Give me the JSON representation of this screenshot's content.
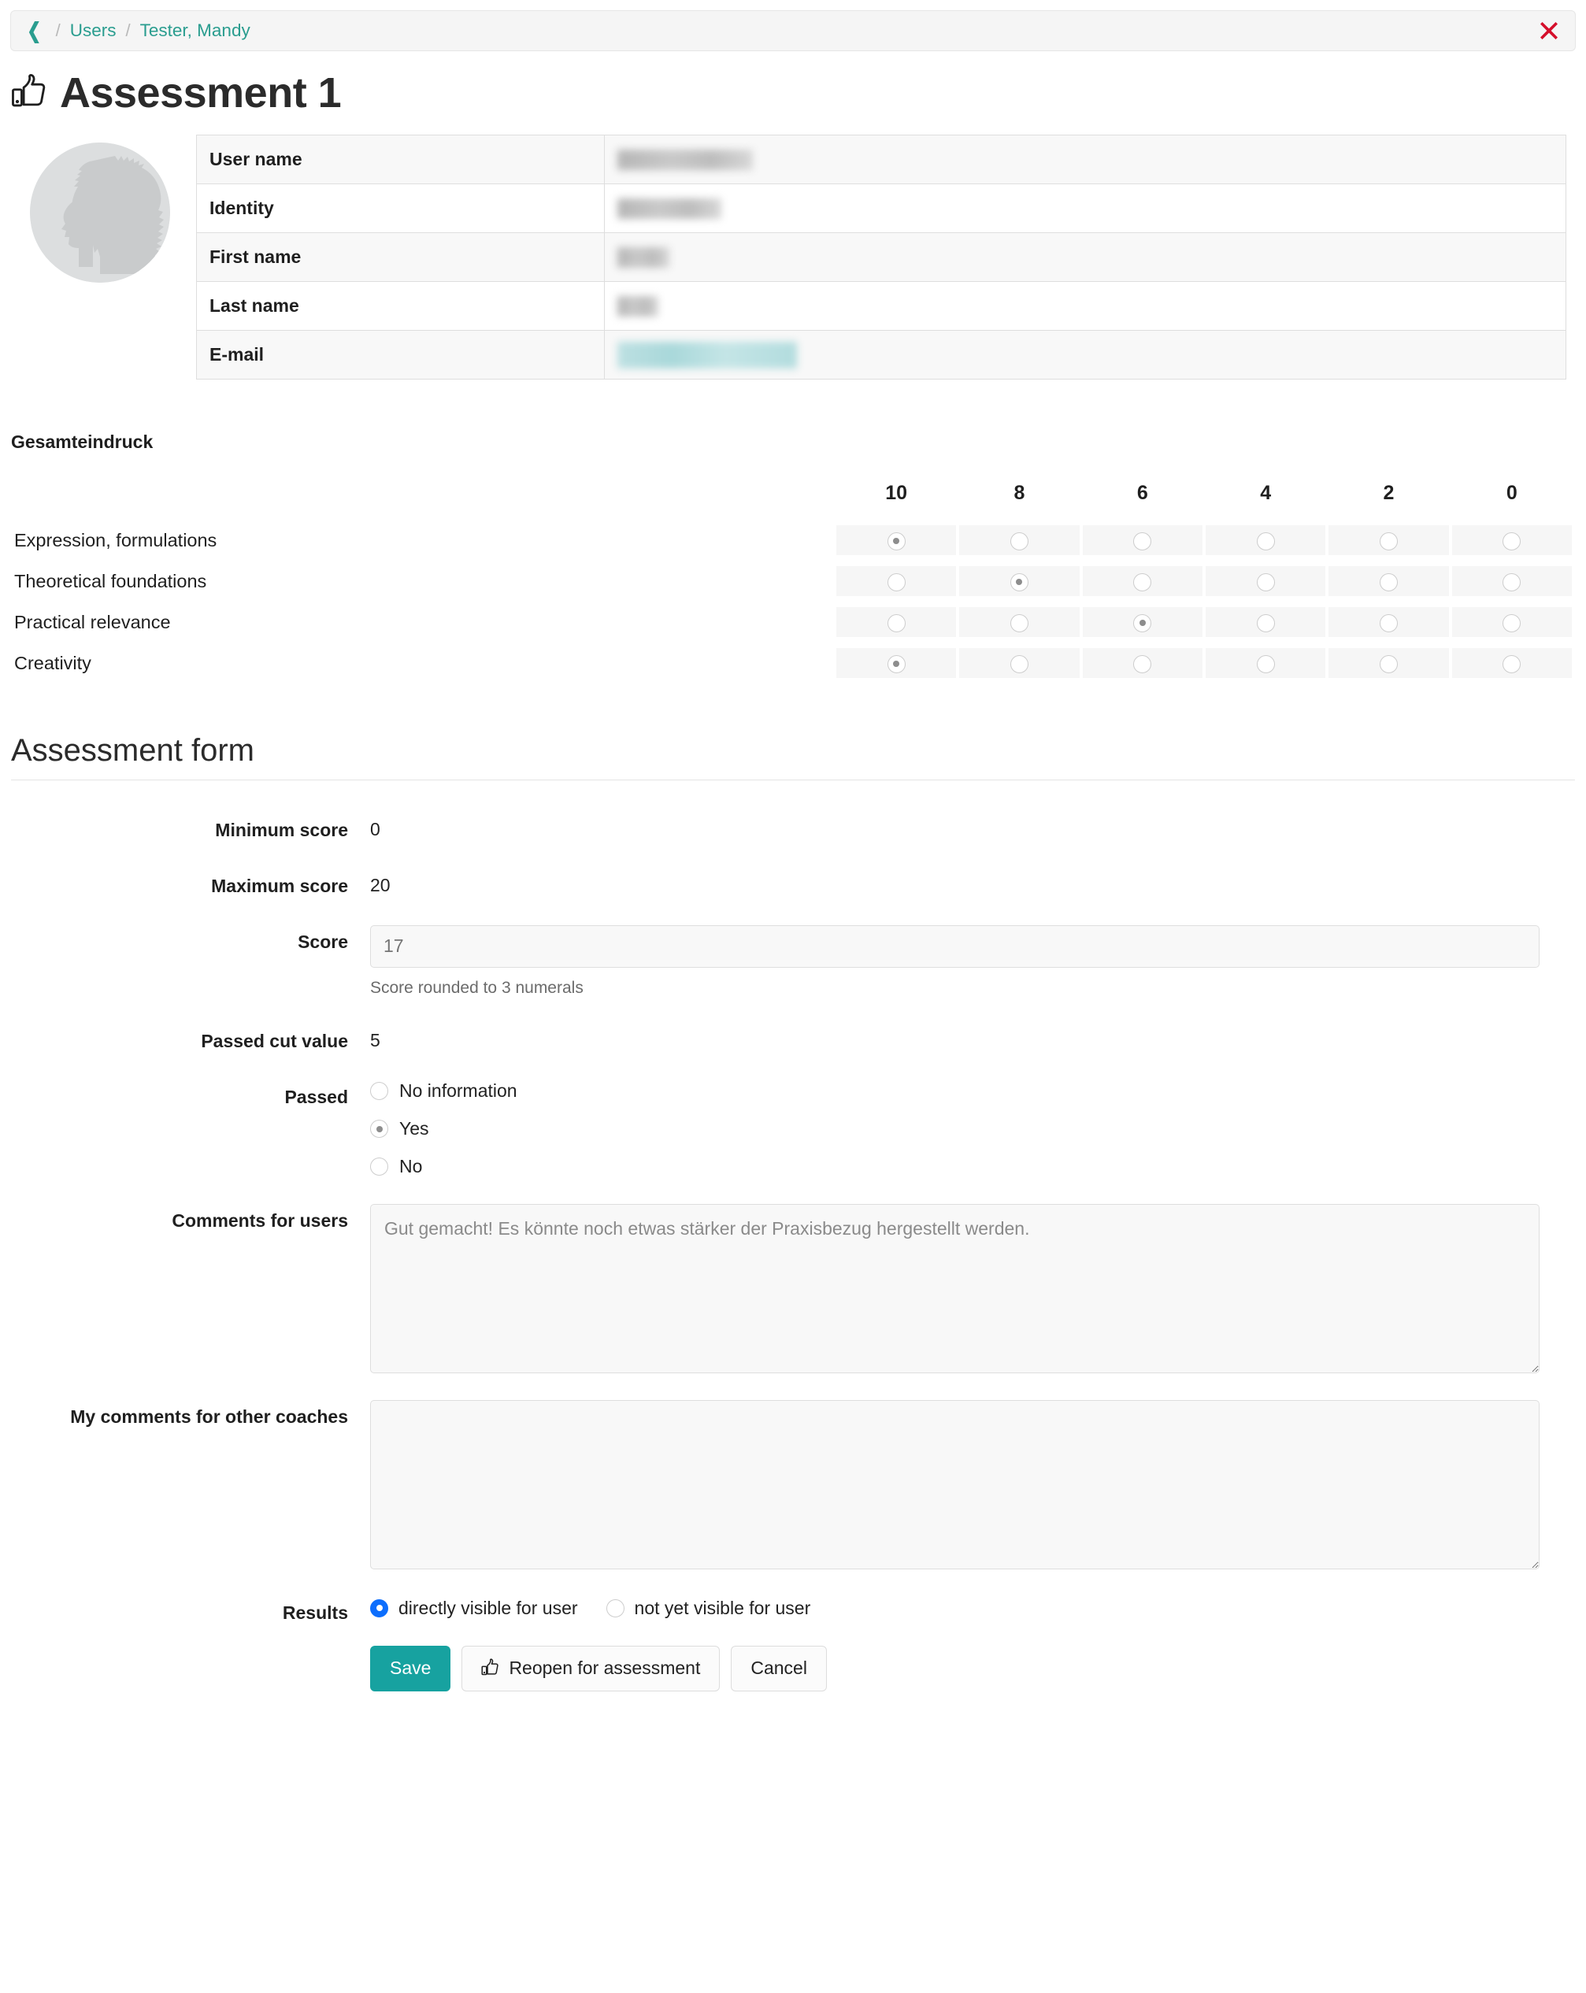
{
  "breadcrumb": {
    "back_icon": "chevron-left-icon",
    "separator": "/",
    "items": [
      {
        "label": "Users"
      },
      {
        "label": "Tester, Mandy"
      }
    ],
    "close_icon": "close-icon",
    "close_color": "#d50f2b"
  },
  "header": {
    "icon": "thumbs-up-icon",
    "title": "Assessment 1"
  },
  "user_info": {
    "avatar_icon": "user-silhouette-avatar",
    "rows": [
      {
        "label": "User name",
        "value": "",
        "redacted": true
      },
      {
        "label": "Identity",
        "value": "",
        "redacted": true
      },
      {
        "label": "First name",
        "value": "",
        "redacted": true
      },
      {
        "label": "Last name",
        "value": "",
        "redacted": true
      },
      {
        "label": "E-mail",
        "value": "",
        "redacted": true
      }
    ]
  },
  "rating_matrix": {
    "title": "Gesamteindruck",
    "columns": [
      "10",
      "8",
      "6",
      "4",
      "2",
      "0"
    ],
    "rows": [
      {
        "label": "Expression, formulations",
        "selected_index": 0
      },
      {
        "label": "Theoretical foundations",
        "selected_index": 1
      },
      {
        "label": "Practical relevance",
        "selected_index": 2
      },
      {
        "label": "Creativity",
        "selected_index": 0
      }
    ]
  },
  "assessment_form": {
    "section_title": "Assessment form",
    "minimum_score": {
      "label": "Minimum score",
      "value": "0"
    },
    "maximum_score": {
      "label": "Maximum score",
      "value": "20"
    },
    "score": {
      "label": "Score",
      "value": "17",
      "placeholder": "17",
      "help": "Score rounded to 3 numerals"
    },
    "passed_cut_value": {
      "label": "Passed cut value",
      "value": "5"
    },
    "passed": {
      "label": "Passed",
      "options": [
        {
          "label": "No information",
          "selected": false
        },
        {
          "label": "Yes",
          "selected": true
        },
        {
          "label": "No",
          "selected": false
        }
      ]
    },
    "comments_for_users": {
      "label": "Comments for users",
      "value": "Gut gemacht! Es könnte noch etwas stärker der Praxisbezug hergestellt werden.",
      "placeholder": ""
    },
    "comments_for_coaches": {
      "label": "My comments for other coaches",
      "value": "",
      "placeholder": ""
    },
    "results": {
      "label": "Results",
      "options": [
        {
          "label": "directly visible for user",
          "selected": true
        },
        {
          "label": "not yet visible for user",
          "selected": false
        }
      ],
      "accent_color": "#0d6efd"
    },
    "buttons": [
      {
        "label": "Save",
        "style": "primary",
        "icon": ""
      },
      {
        "label": "Reopen for assessment",
        "style": "light",
        "icon": "thumbs-up-icon"
      },
      {
        "label": "Cancel",
        "style": "light",
        "icon": ""
      }
    ]
  },
  "theme": {
    "accent_teal": "#2a9d8f",
    "button_teal": "#17a2a0",
    "danger_red": "#d50f2b",
    "radio_blue": "#0d6efd"
  }
}
